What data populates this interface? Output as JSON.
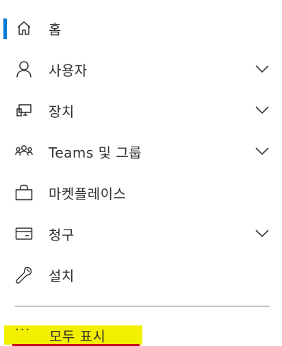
{
  "nav": {
    "items": [
      {
        "label": "홈",
        "icon": "home-icon",
        "active": true,
        "expandable": false
      },
      {
        "label": "사용자",
        "icon": "person-icon",
        "active": false,
        "expandable": true
      },
      {
        "label": "장치",
        "icon": "devices-icon",
        "active": false,
        "expandable": true
      },
      {
        "label": "Teams 및 그룹",
        "icon": "group-icon",
        "active": false,
        "expandable": true
      },
      {
        "label": "마켓플레이스",
        "icon": "shopping-bag-icon",
        "active": false,
        "expandable": false
      },
      {
        "label": "청구",
        "icon": "credit-card-icon",
        "active": false,
        "expandable": true
      },
      {
        "label": "설치",
        "icon": "wrench-icon",
        "active": false,
        "expandable": false
      }
    ],
    "show_all": {
      "dots": "···",
      "label": "모두 표시"
    }
  },
  "colors": {
    "accent": "#0078d4",
    "highlight": "#f2ef00",
    "underline": "#d0021b",
    "text": "#323130",
    "divider": "#c8c6c4"
  }
}
